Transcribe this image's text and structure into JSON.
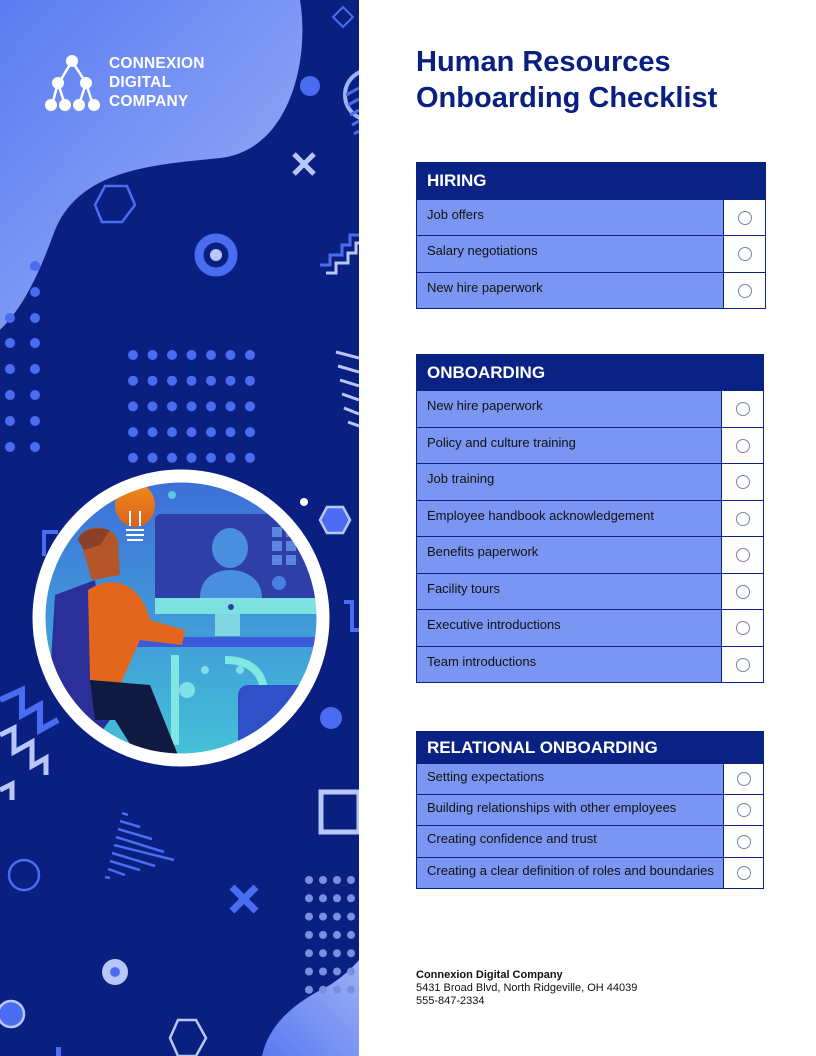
{
  "brand": {
    "name_lines": [
      "CONNEXION",
      "DIGITAL",
      "COMPANY"
    ],
    "logo_icon": "org-tree-icon"
  },
  "title_lines": [
    "Human Resources",
    "Onboarding Checklist"
  ],
  "colors": {
    "navy": "#0a2080",
    "row_fill": "#7b96f2",
    "light_blob": "#8ea6f5",
    "accent_blue": "#4a6cf0"
  },
  "sections": [
    {
      "heading": "HIRING",
      "items": [
        "Job offers",
        "Salary negotiations",
        "New hire paperwork"
      ]
    },
    {
      "heading": "ONBOARDING",
      "items": [
        "New hire paperwork",
        "Policy and culture training",
        "Job training",
        "Employee handbook acknowledgement",
        "Benefits paperwork",
        "Facility tours",
        "Executive introductions",
        "Team introductions"
      ]
    },
    {
      "heading": "RELATIONAL ONBOARDING",
      "items": [
        "Setting expectations",
        "Building relationships with other employees",
        "Creating confidence and trust",
        "Creating a clear definition of roles and boundaries"
      ]
    }
  ],
  "footer": {
    "company": "Connexion Digital Company",
    "address": "5431 Broad Blvd, North Ridgeville, OH 44039",
    "phone": "555-847-2334"
  }
}
